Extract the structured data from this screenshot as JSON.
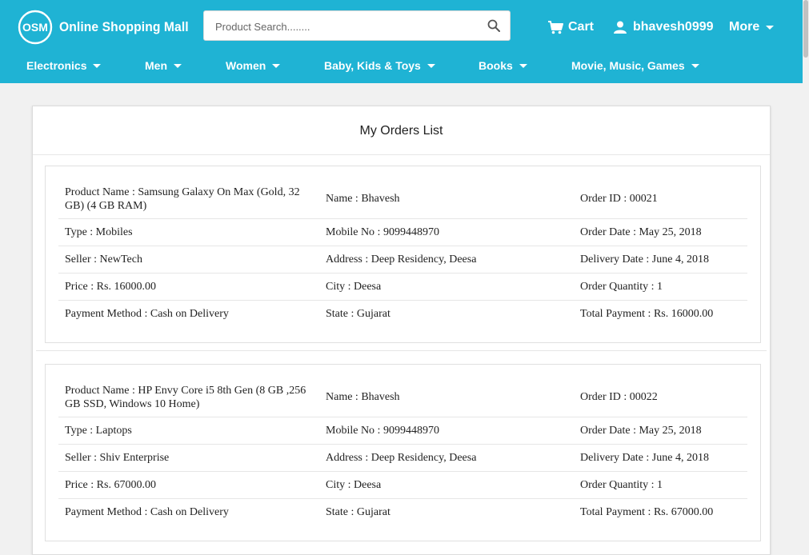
{
  "header": {
    "logo_text": "Online Shopping Mall",
    "search_placeholder": "Product Search........",
    "cart_label": "Cart",
    "user_label": "bhavesh0999",
    "more_label": "More"
  },
  "categories": [
    {
      "label": "Electronics"
    },
    {
      "label": "Men"
    },
    {
      "label": "Women"
    },
    {
      "label": "Baby, Kids & Toys"
    },
    {
      "label": "Books"
    },
    {
      "label": "Movie, Music, Games"
    }
  ],
  "page": {
    "title": "My Orders List"
  },
  "orders": [
    {
      "product_name": "Product Name : Samsung Galaxy On Max (Gold, 32 GB) (4 GB RAM)",
      "name": "Name : Bhavesh",
      "order_id": "Order ID : 00021",
      "type": "Type : Mobiles",
      "mobile": "Mobile No : 9099448970",
      "order_date": "Order Date : May 25, 2018",
      "seller": "Seller : NewTech",
      "address": "Address : Deep Residency, Deesa",
      "delivery_date": "Delivery Date : June 4, 2018",
      "price": "Price : Rs. 16000.00",
      "city": "City : Deesa",
      "quantity": "Order Quantity : 1",
      "payment_method": "Payment Method : Cash on Delivery",
      "state": "State : Gujarat",
      "total_payment": "Total Payment : Rs. 16000.00"
    },
    {
      "product_name": "Product Name : HP Envy Core i5 8th Gen (8 GB ,256 GB SSD, Windows 10 Home)",
      "name": "Name : Bhavesh",
      "order_id": "Order ID : 00022",
      "type": "Type : Laptops",
      "mobile": "Mobile No : 9099448970",
      "order_date": "Order Date : May 25, 2018",
      "seller": "Seller : Shiv Enterprise",
      "address": "Address : Deep Residency, Deesa",
      "delivery_date": "Delivery Date : June 4, 2018",
      "price": "Price : Rs. 67000.00",
      "city": "City : Deesa",
      "quantity": "Order Quantity : 1",
      "payment_method": "Payment Method : Cash on Delivery",
      "state": "State : Gujarat",
      "total_payment": "Total Payment : Rs. 67000.00"
    }
  ],
  "colors": {
    "header_bg": "#1fb3d4",
    "page_bg": "#f1f1f1"
  }
}
